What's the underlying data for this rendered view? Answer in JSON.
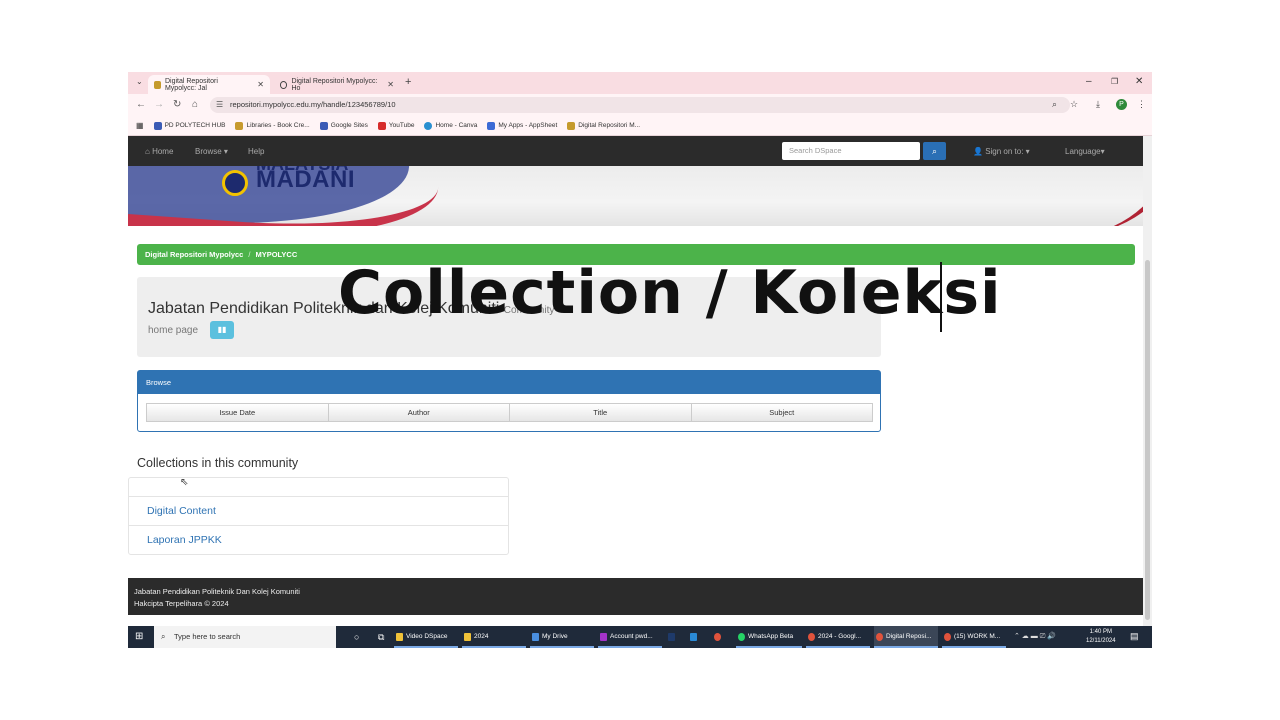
{
  "browser": {
    "tabs": [
      {
        "label": "Digital Repositori Mypolycc: Jal"
      },
      {
        "label": "Digital Repositori Mypolycc: Ho"
      }
    ],
    "url": "repositori.mypolycc.edu.my/handle/123456789/10",
    "bookmarks": [
      {
        "label": "PD POLYTECH HUB",
        "color": "#3b5bb5"
      },
      {
        "label": "Libraries - Book Cre...",
        "color": "#c79a2e"
      },
      {
        "label": "Google Sites",
        "color": "#3b5bb5"
      },
      {
        "label": "YouTube",
        "color": "#d62b2b"
      },
      {
        "label": "Home - Canva",
        "color": "#2a8fd0"
      },
      {
        "label": "My Apps - AppSheet",
        "color": "#3b6ad5"
      },
      {
        "label": "Digital Repositori M...",
        "color": "#c59a2c"
      }
    ],
    "profile_initial": "P"
  },
  "dspace_nav": {
    "home": "Home",
    "browse": "Browse",
    "help": "Help",
    "search_placeholder": "Search DSpace",
    "sign_on": "Sign on to:",
    "language": "Language"
  },
  "banner": {
    "logo_text": "MADANI",
    "logo_top_text": "MALAYSIA"
  },
  "breadcrumb": {
    "root": "Digital Repositori Mypolycc",
    "separator": "/",
    "current": "MYPOLYCC"
  },
  "community": {
    "title": "Jabatan Pendidikan Politeknik dan Kolej Komuniti",
    "suffix": "Community",
    "subtitle": "home page"
  },
  "browse_panel": {
    "heading": "Browse",
    "buttons": [
      "Issue Date",
      "Author",
      "Title",
      "Subject"
    ]
  },
  "overlay_caption": "Collection / Koleksi",
  "collections": {
    "heading": "Collections in this community",
    "items": [
      "Digital Content",
      "Laporan JPPKK"
    ]
  },
  "footer": {
    "line1": "Jabatan Pendidikan Politeknik Dan Kolej Komuniti",
    "line2": "Hakcipta Terpelihara © 2024"
  },
  "taskbar": {
    "search_placeholder": "Type here to search",
    "apps": [
      {
        "label": "Video DSpace",
        "color": "#f0c239"
      },
      {
        "label": "2024",
        "color": "#f0c239"
      },
      {
        "label": "My Drive",
        "color": "#4a8fe0"
      },
      {
        "label": "Account pwd...",
        "color": "#a333c8"
      },
      {
        "label": "WhatsApp Beta",
        "color": "#25d366"
      },
      {
        "label": "2024 - Googl...",
        "color": "#e0533c"
      },
      {
        "label": "Digital Reposi...",
        "color": "#e0533c"
      },
      {
        "label": "(15) WORK M...",
        "color": "#e0533c"
      }
    ],
    "time": "1:40 PM",
    "date": "12/11/2024"
  },
  "colors": {
    "navbar": "#2b2b2b",
    "breadcrumb_bg": "#4cb34a",
    "panel_primary": "#2f73b3",
    "info_button": "#5bc0de",
    "link": "#2f73b3"
  }
}
